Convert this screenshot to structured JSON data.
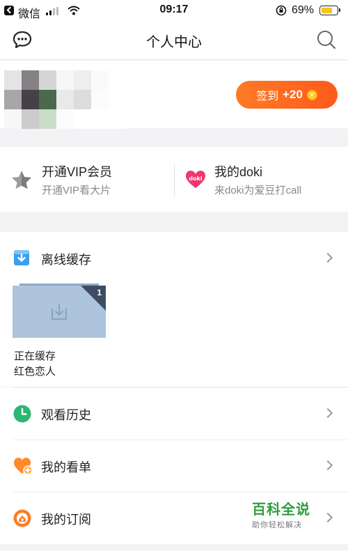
{
  "status_bar": {
    "back_app": "微信",
    "time": "09:17",
    "battery_percent": "69%",
    "battery_level": 0.69
  },
  "nav": {
    "title": "个人中心"
  },
  "profile": {
    "signin_label": "签到",
    "signin_bonus": "+20",
    "coin_glyph": "V"
  },
  "promo": {
    "vip_title": "开通VIP会员",
    "vip_subtitle": "开通VIP看大片",
    "doki_title": "我的doki",
    "doki_subtitle": "来doki为爱豆打call"
  },
  "offline_cache": {
    "label": "离线缓存",
    "badge_count": "1",
    "status_text": "正在缓存",
    "item_name": "红色恋人"
  },
  "menu": {
    "history_label": "观看历史",
    "watchlist_label": "我的看单",
    "subscription_label": "我的订阅"
  },
  "watermark": {
    "main": "百科全说",
    "sub": "助你轻松解决"
  },
  "colors": {
    "accent_orange": "#ff6a1f",
    "history_green": "#2bb673",
    "cache_blue": "#3aa0f0",
    "doki_pink": "#f2366e"
  }
}
